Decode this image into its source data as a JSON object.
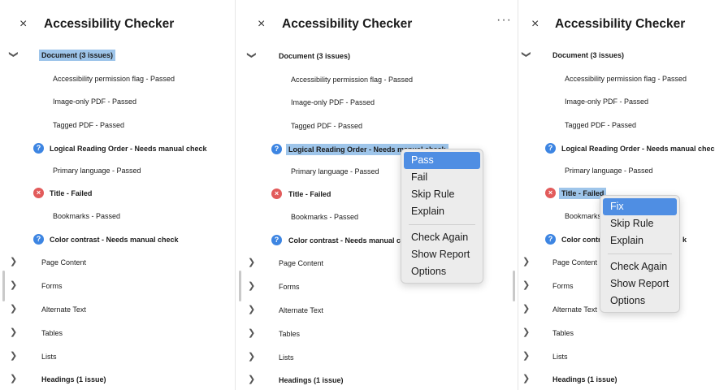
{
  "title": "Accessibility Checker",
  "close_glyph": "×",
  "more_glyph": "···",
  "panel1": {
    "items": [
      {
        "label": "Document (3 issues)"
      },
      {
        "label": "Accessibility permission flag - Passed"
      },
      {
        "label": "Image-only PDF - Passed"
      },
      {
        "label": "Tagged PDF - Passed"
      },
      {
        "label": "Logical Reading Order - Needs manual check"
      },
      {
        "label": "Primary language - Passed"
      },
      {
        "label": "Title - Failed"
      },
      {
        "label": "Bookmarks - Passed"
      },
      {
        "label": "Color contrast - Needs manual check"
      },
      {
        "label": "Page Content"
      },
      {
        "label": "Forms"
      },
      {
        "label": "Alternate Text"
      },
      {
        "label": "Tables"
      },
      {
        "label": "Lists"
      },
      {
        "label": "Headings (1 issue)"
      }
    ]
  },
  "panel2": {
    "items": [
      {
        "label": "Document (3 issues)"
      },
      {
        "label": "Accessibility permission flag - Passed"
      },
      {
        "label": "Image-only PDF - Passed"
      },
      {
        "label": "Tagged PDF - Passed"
      },
      {
        "label": "Logical Reading Order - Needs manual check"
      },
      {
        "label": "Primary language - Passed"
      },
      {
        "label": "Title - Failed"
      },
      {
        "label": "Bookmarks - Passed"
      },
      {
        "label": "Color contrast - Needs manual ch"
      },
      {
        "label": "Page Content"
      },
      {
        "label": "Forms"
      },
      {
        "label": "Alternate Text"
      },
      {
        "label": "Tables"
      },
      {
        "label": "Lists"
      },
      {
        "label": "Headings (1 issue)"
      }
    ],
    "menu": [
      "Pass",
      "Fail",
      "Skip Rule",
      "Explain",
      "Check Again",
      "Show Report",
      "Options"
    ]
  },
  "panel3": {
    "items": [
      {
        "label": "Document (3 issues)"
      },
      {
        "label": "Accessibility permission flag - Passed"
      },
      {
        "label": "Image-only PDF - Passed"
      },
      {
        "label": "Tagged PDF - Passed"
      },
      {
        "label": "Logical Reading Order - Needs manual check"
      },
      {
        "label": "Primary language - Passed"
      },
      {
        "label": "Title - Failed"
      },
      {
        "label": "Bookmarks"
      },
      {
        "label": "Color contr"
      },
      {
        "label": "k"
      },
      {
        "label": "Page Content"
      },
      {
        "label": "Forms"
      },
      {
        "label": "Alternate Text"
      },
      {
        "label": "Tables"
      },
      {
        "label": "Lists"
      },
      {
        "label": "Headings (1 issue)"
      }
    ],
    "menu": [
      "Fix",
      "Skip Rule",
      "Explain",
      "Check Again",
      "Show Report",
      "Options"
    ]
  },
  "colors": {
    "highlight": "#9ec5ea",
    "menu_selected": "#4f8ee3",
    "question_icon": "#3d85e2",
    "failed_icon": "#e25b5b"
  },
  "icons": [
    "close-icon",
    "more-icon",
    "chevron-down-icon",
    "chevron-right-icon",
    "question-icon",
    "failed-icon"
  ]
}
